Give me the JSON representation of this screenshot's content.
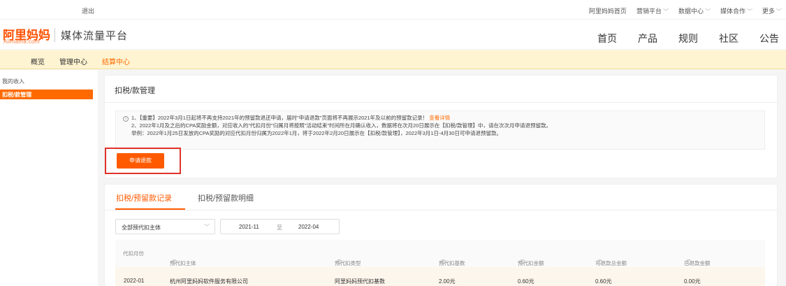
{
  "topbar": {
    "logout": "退出",
    "links": [
      "阿里妈妈首页",
      "营销平台",
      "数据中心",
      "媒体合作",
      "更多"
    ]
  },
  "header": {
    "logo_cn": "阿里妈妈",
    "logo_en": "Alimama.com",
    "platform": "媒体流量平台",
    "nav": [
      "首页",
      "产品",
      "规则",
      "社区",
      "公告"
    ]
  },
  "subnav": {
    "items": [
      "概览",
      "管理中心",
      "结算中心"
    ],
    "active": "结算中心"
  },
  "sidebar": {
    "items": [
      "我的收入",
      "扣税/款管理"
    ]
  },
  "card1": {
    "title": "扣税/款管理",
    "notice": {
      "line1": "1、【重要】2022年3月1日起将不再支持2021年的预留款退还申请，届时\"申请退款\"页面将不再展示2021年及以前的预留款记录！",
      "line1_link": "查看详情",
      "line2": "2、2022年1月及之后的CPA奖励金额，对应收入的\"代扣月份\"归属月将按照\"活动结束\"时间所在月确认收入，数据将在次月20日展示在【扣税/款管理】中，请在次次月申请退预留款。",
      "line3": "举例：2022年1月25日发放的CPA奖励的对应代扣月份归属为2022年1月，将于2022年2月20日展示在【扣税/款管理】，2022年3月1日-4月30日可申请退预留款。"
    },
    "apply_button": "申请退款"
  },
  "card2": {
    "tabs": [
      "扣税/预留款记录",
      "扣税/预留款明细"
    ],
    "filter": {
      "entity_select": "全部预代扣主体",
      "date_start": "2021-11",
      "date_sep": "至",
      "date_end": "2022-04"
    },
    "columns": [
      "代扣月份",
      "预代扣主体",
      "预代扣类型",
      "预代扣基数",
      "预代扣金额",
      "可退款总金额",
      "已退款金额"
    ],
    "rows": [
      [
        "2022-01",
        "杭州阿里妈妈软件服务有限公司",
        "阿里妈妈预代扣基数",
        "2.00元",
        "0.60元",
        "0.60元",
        "0.00元"
      ]
    ]
  },
  "colors": {
    "accent": "#ff5a00",
    "subnav_bg": "#fff4d1",
    "highlight": "#e0322a"
  }
}
